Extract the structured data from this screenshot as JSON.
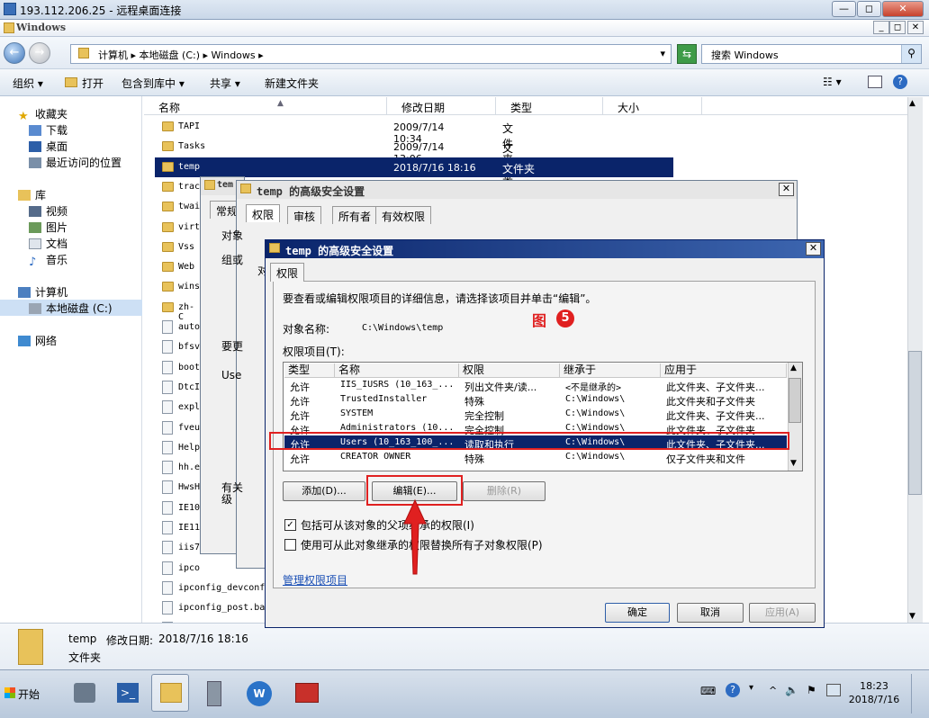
{
  "rdp": {
    "title": "193.112.206.25 - 远程桌面连接",
    "min": "—",
    "restore": "◻",
    "close": "✕"
  },
  "explorer": {
    "title": "Windows",
    "address": [
      "计算机",
      "本地磁盘 (C:)",
      "Windows"
    ],
    "search_placeholder": "搜索 Windows",
    "commands": [
      "组织 ▾",
      "打开",
      "包含到库中 ▾",
      "共享 ▾",
      "新建文件夹"
    ],
    "nav": [
      {
        "label": "收藏夹",
        "icon": "star-icon"
      },
      {
        "label": "下载",
        "icon": "download-folder-icon"
      },
      {
        "label": "桌面",
        "icon": "desktop-icon"
      },
      {
        "label": "最近访问的位置",
        "icon": "recent-places-icon"
      },
      {
        "label": "库",
        "icon": "library-icon"
      },
      {
        "label": "视频",
        "icon": "video-icon"
      },
      {
        "label": "图片",
        "icon": "pictures-icon"
      },
      {
        "label": "文档",
        "icon": "documents-icon"
      },
      {
        "label": "音乐",
        "icon": "music-icon"
      },
      {
        "label": "计算机",
        "icon": "computer-icon"
      },
      {
        "label": "本地磁盘 (C:)",
        "icon": "drive-icon"
      },
      {
        "label": "网络",
        "icon": "network-icon"
      }
    ],
    "columns": [
      "名称",
      "修改日期",
      "类型",
      "大小"
    ],
    "rows": [
      {
        "name": "TAPI",
        "date": "2009/7/14 10:34",
        "type": "文件夹",
        "kind": "folder"
      },
      {
        "name": "Tasks",
        "date": "2009/7/14 13:06",
        "type": "文件夹",
        "kind": "folder"
      },
      {
        "name": "temp",
        "date": "2018/7/16 18:16",
        "type": "文件夹",
        "kind": "folder"
      },
      {
        "name": "trac",
        "date": "",
        "type": "",
        "kind": "folder"
      },
      {
        "name": "twai",
        "date": "",
        "type": "",
        "kind": "folder"
      },
      {
        "name": "virt",
        "date": "",
        "type": "",
        "kind": "folder"
      },
      {
        "name": "Vss",
        "date": "",
        "type": "",
        "kind": "folder"
      },
      {
        "name": "Web",
        "date": "",
        "type": "",
        "kind": "folder"
      },
      {
        "name": "wins",
        "date": "",
        "type": "",
        "kind": "folder"
      },
      {
        "name": "zh-C",
        "date": "",
        "type": "",
        "kind": "folder"
      },
      {
        "name": "auto",
        "date": "",
        "type": "",
        "kind": "file"
      },
      {
        "name": "bfsv",
        "date": "",
        "type": "",
        "kind": "file"
      },
      {
        "name": "boot",
        "date": "",
        "type": "",
        "kind": "file"
      },
      {
        "name": "DtcI",
        "date": "",
        "type": "",
        "kind": "file"
      },
      {
        "name": "expl",
        "date": "",
        "type": "",
        "kind": "file"
      },
      {
        "name": "fveu",
        "date": "",
        "type": "",
        "kind": "file"
      },
      {
        "name": "Help",
        "date": "",
        "type": "",
        "kind": "file"
      },
      {
        "name": "hh.e",
        "date": "",
        "type": "",
        "kind": "file"
      },
      {
        "name": "HwsH",
        "date": "",
        "type": "",
        "kind": "file"
      },
      {
        "name": "IE10",
        "date": "",
        "type": "",
        "kind": "file"
      },
      {
        "name": "IE11",
        "date": "",
        "type": "",
        "kind": "file"
      },
      {
        "name": "iis7",
        "date": "",
        "type": "",
        "kind": "file"
      },
      {
        "name": "ipco",
        "date": "",
        "type": "",
        "kind": "file"
      },
      {
        "name": "ipconfig_devconf",
        "date": "",
        "type": "",
        "kind": "file"
      },
      {
        "name": "ipconfig_post.ba",
        "date": "",
        "type": "",
        "kind": "file"
      },
      {
        "name": "ipconfig_post.1",
        "date": "",
        "type": "",
        "kind": "file"
      }
    ],
    "details": {
      "name": "temp",
      "date_label": "修改日期:",
      "date": "2018/7/16 18:16",
      "type": "文件夹"
    }
  },
  "dialog_back": {
    "title": "temp 的高级安全设置",
    "tabs": [
      "权限",
      "审核",
      "所有者",
      "有效权限"
    ],
    "back_title": "tem",
    "back_tab": "常规",
    "partial": [
      "对象",
      "组或",
      "对",
      "要更",
      "Use",
      "有关",
      "级"
    ]
  },
  "dialog": {
    "title": "temp 的高级安全设置",
    "tab": "权限",
    "intro": "要查看或编辑权限项目的详细信息，请选择该项目并单击“编辑”。",
    "object_label": "对象名称:",
    "object_value": "C:\\Windows\\temp",
    "entries_label": "权限项目(T):",
    "headers": [
      "类型",
      "名称",
      "权限",
      "继承于",
      "应用于"
    ],
    "entries": [
      {
        "type": "允许",
        "name": "IIS_IUSRS (10_163_...",
        "perm": "列出文件夹/读...",
        "inherit": "<不是继承的>",
        "apply": "此文件夹、子文件夹..."
      },
      {
        "type": "允许",
        "name": "TrustedInstaller",
        "perm": "特殊",
        "inherit": "C:\\Windows\\",
        "apply": "此文件夹和子文件夹"
      },
      {
        "type": "允许",
        "name": "SYSTEM",
        "perm": "完全控制",
        "inherit": "C:\\Windows\\",
        "apply": "此文件夹、子文件夹..."
      },
      {
        "type": "允许",
        "name": "Administrators (10...",
        "perm": "完全控制",
        "inherit": "C:\\Windows\\",
        "apply": "此文件夹、子文件夹..."
      },
      {
        "type": "允许",
        "name": "Users (10_163_100_...",
        "perm": "读取和执行",
        "inherit": "C:\\Windows\\",
        "apply": "此文件夹、子文件夹..."
      },
      {
        "type": "允许",
        "name": "CREATOR OWNER",
        "perm": "特殊",
        "inherit": "C:\\Windows\\",
        "apply": "仅子文件夹和文件"
      }
    ],
    "add": "添加(D)...",
    "edit": "编辑(E)...",
    "remove": "删除(R)",
    "chk1": "包括可从该对象的父项继承的权限(I)",
    "chk2": "使用可从此对象继承的权限替换所有子对象权限(P)",
    "manage_link": "管理权限项目",
    "ok": "确定",
    "cancel": "取消",
    "apply": "应用(A)"
  },
  "annotation": {
    "label": "图",
    "number": "5"
  },
  "taskbar": {
    "start": "开始",
    "time": "18:23",
    "date": "2018/7/16"
  },
  "colors": {
    "selection": "#0a246a",
    "highlight": "#e02020"
  }
}
